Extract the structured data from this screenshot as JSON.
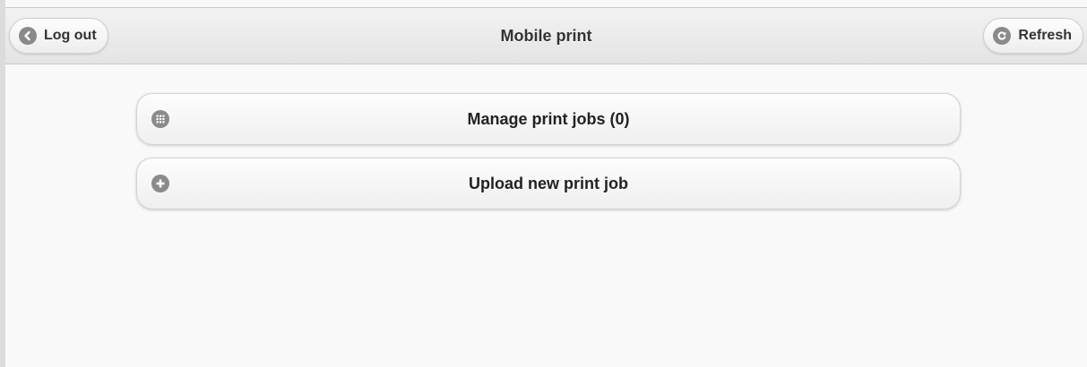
{
  "header": {
    "title": "Mobile print",
    "logout_label": "Log out",
    "refresh_label": "Refresh"
  },
  "menu": {
    "items": [
      {
        "label": "Manage print jobs (0)",
        "icon": "grid-icon"
      },
      {
        "label": "Upload new print job",
        "icon": "plus-icon"
      }
    ]
  },
  "colors": {
    "icon_disc": "#8a8a8a",
    "text": "#333333",
    "background": "#f9f9f9"
  }
}
